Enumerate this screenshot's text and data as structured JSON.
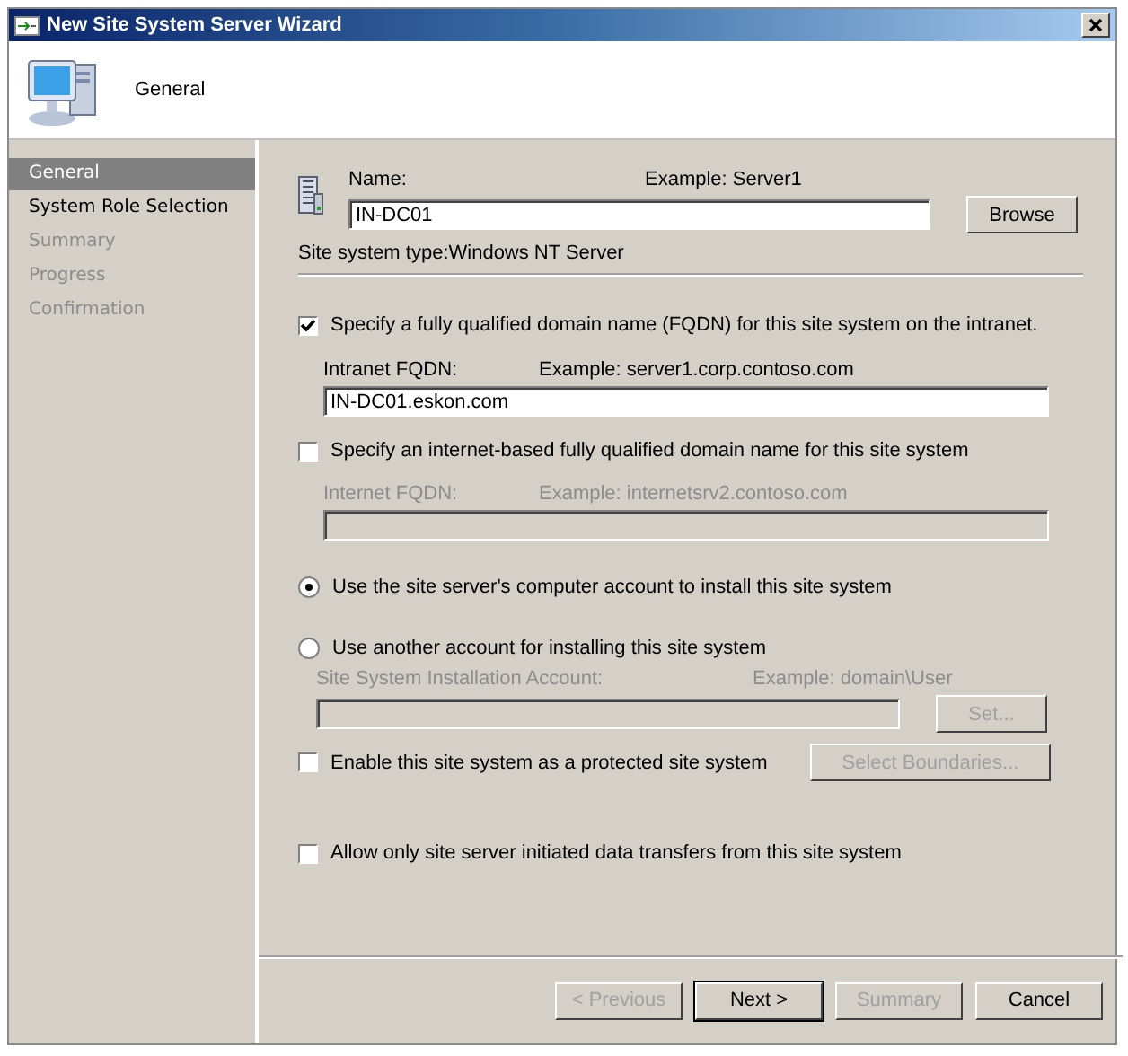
{
  "window": {
    "title": "New Site System Server Wizard"
  },
  "header": {
    "title": "General"
  },
  "nav": [
    {
      "label": "General",
      "selected": true,
      "disabled": false
    },
    {
      "label": "System Role Selection",
      "selected": false,
      "disabled": false
    },
    {
      "label": "Summary",
      "selected": false,
      "disabled": true
    },
    {
      "label": "Progress",
      "selected": false,
      "disabled": true
    },
    {
      "label": "Confirmation",
      "selected": false,
      "disabled": true
    }
  ],
  "name_field": {
    "label": "Name:",
    "example": "Example: Server1",
    "value": "IN-DC01",
    "button": "Browse"
  },
  "site_system_type": "Site system type:Windows NT Server",
  "intranet": {
    "label": "Specify a fully qualified domain name (FQDN) for this site system on the intranet.",
    "checked": true,
    "field_label": "Intranet FQDN:",
    "example": "Example: server1.corp.contoso.com",
    "value": "IN-DC01.eskon.com",
    "disabled": false
  },
  "internet": {
    "label": "Specify an internet-based fully qualified domain name for this site system",
    "checked": false,
    "field_label": "Internet FQDN:",
    "example": "Example: internetsrv2.contoso.com",
    "disabled": true
  },
  "account_options": [
    {
      "label": "Use the site server's computer account to install this site system",
      "selected": true
    },
    {
      "label": "Use another account for installing this site system",
      "selected": false
    }
  ],
  "account": {
    "label": "Site System Installation Account:",
    "example": "Example: domain\\User",
    "button": "Set...",
    "disabled": true
  },
  "protected": {
    "label": "Enable this site system as a protected site system",
    "checked": false,
    "button": "Select Boundaries...",
    "button_disabled": true
  },
  "allow_only": {
    "label": "Allow only site server initiated data transfers from this site system",
    "checked": false
  },
  "buttons": [
    {
      "label": "< Previous",
      "disabled": true,
      "default": false
    },
    {
      "label": "Next >",
      "disabled": false,
      "default": true
    },
    {
      "label": "Summary",
      "disabled": true,
      "default": false
    },
    {
      "label": "Cancel",
      "disabled": false,
      "default": false
    }
  ]
}
